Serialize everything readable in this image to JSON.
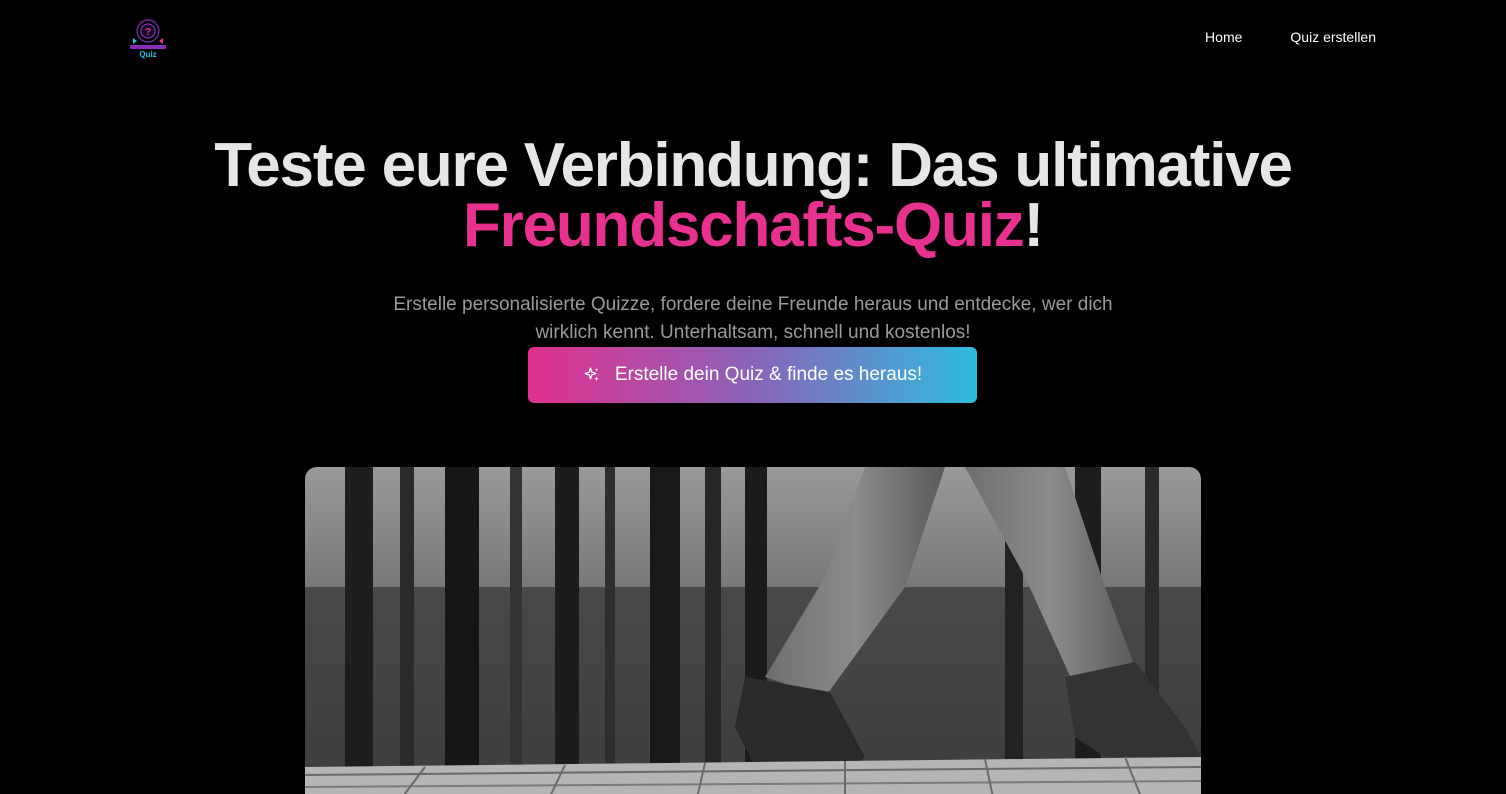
{
  "nav": {
    "logo_icon": "quiz-logo",
    "logo_text": "Quiz",
    "links": [
      {
        "label": "Home"
      },
      {
        "label": "Quiz erstellen"
      }
    ]
  },
  "hero": {
    "title_line1": "Teste eure Verbindung: Das ultimative",
    "title_accent": "Freundschafts-Quiz",
    "title_suffix": "!",
    "subtitle": "Erstelle personalisierte Quizze, fordere deine Freunde heraus und entdecke, wer dich wirklich kennt. Unterhaltsam, schnell und kostenlos!",
    "cta_label": "Erstelle dein Quiz & finde es heraus!",
    "cta_icon": "sparkles-icon"
  },
  "image": {
    "content": "grayscale forest photo of feet walking on a wooden boardwalk"
  },
  "colors": {
    "background": "#000000",
    "accent_pink": "#e8308f",
    "accent_cyan": "#2fbcdf",
    "title": "#e6e6e6",
    "subtitle": "#9a9a9a"
  }
}
